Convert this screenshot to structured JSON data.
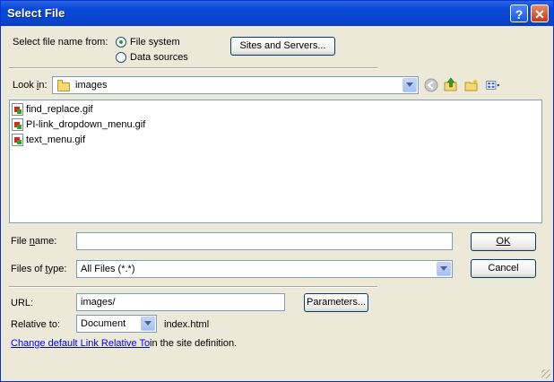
{
  "window": {
    "title": "Select File"
  },
  "source": {
    "label": "Select file name from:",
    "options": [
      {
        "label": "File system",
        "selected": true
      },
      {
        "label": "Data sources",
        "selected": false
      }
    ],
    "sites_button": "Sites and Servers..."
  },
  "lookin": {
    "label_pre": "Look ",
    "label_key": "i",
    "label_post": "n:",
    "value": "images"
  },
  "files": [
    {
      "name": "find_replace.gif",
      "icon": "gif-file-icon"
    },
    {
      "name": "PI-link_dropdown_menu.gif",
      "icon": "gif-file-icon"
    },
    {
      "name": "text_menu.gif",
      "icon": "gif-file-icon"
    }
  ],
  "filename": {
    "label_pre": "File ",
    "label_key": "n",
    "label_post": "ame:",
    "value": ""
  },
  "filetype": {
    "label_pre": "Files of ",
    "label_key": "t",
    "label_post": "ype:",
    "value": "All Files (*.*)"
  },
  "buttons": {
    "ok": "OK",
    "cancel": "Cancel",
    "parameters": "Parameters..."
  },
  "url": {
    "label": "URL:",
    "value": "images/"
  },
  "relative": {
    "label": "Relative to:",
    "value": "Document",
    "file": "index.html"
  },
  "footer": {
    "link": "Change default Link Relative To",
    "rest": " in the site definition."
  },
  "colors": {
    "titlebar": "#0846d2",
    "face": "#ece9d8",
    "link": "#0000ff"
  }
}
